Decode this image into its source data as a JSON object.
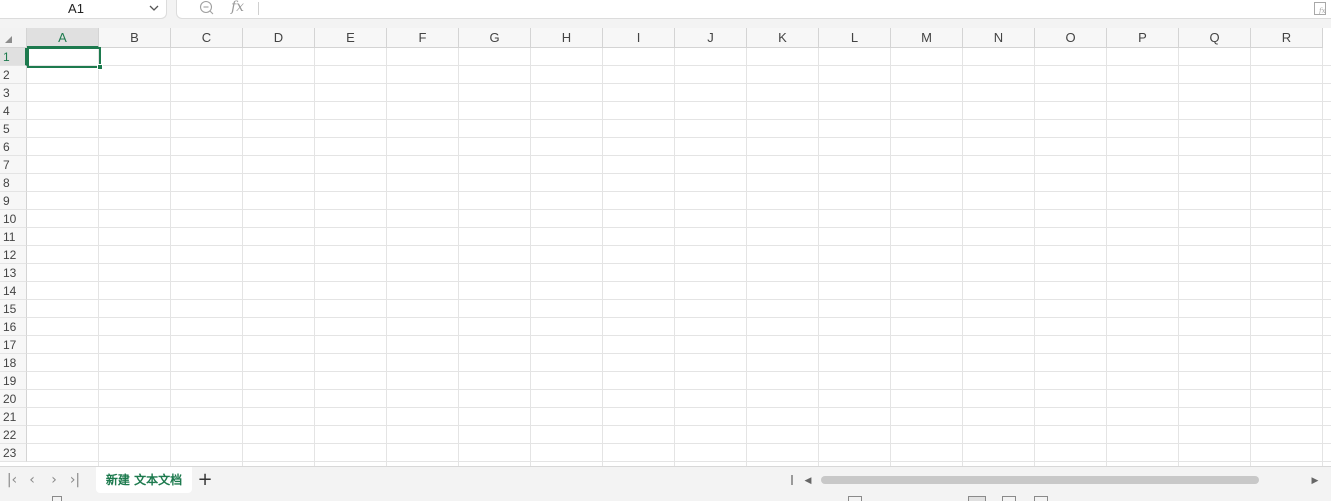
{
  "formula_bar": {
    "name_box": "A1",
    "fx_label": "fx",
    "formula_value": ""
  },
  "grid": {
    "columns": [
      "A",
      "B",
      "C",
      "D",
      "E",
      "F",
      "G",
      "H",
      "I",
      "J",
      "K",
      "L",
      "M",
      "N",
      "O",
      "P",
      "Q",
      "R"
    ],
    "rows": [
      "1",
      "2",
      "3",
      "4",
      "5",
      "6",
      "7",
      "8",
      "9",
      "10",
      "11",
      "12",
      "13",
      "14",
      "15",
      "16",
      "17",
      "18",
      "19",
      "20",
      "21",
      "22",
      "23"
    ],
    "active_cell": "A1",
    "active_column": "A",
    "active_row": "1"
  },
  "sheet_bar": {
    "tabs": [
      {
        "label": "新建 文本文档",
        "active": true
      }
    ],
    "add_label": "+",
    "nav_icons": [
      "first-sheet-icon",
      "prev-sheet-icon",
      "next-sheet-icon",
      "last-sheet-icon"
    ]
  },
  "colors": {
    "accent": "#1d7a4e",
    "header_bg": "#f7f7f7",
    "gridline": "#e4e4e4"
  }
}
